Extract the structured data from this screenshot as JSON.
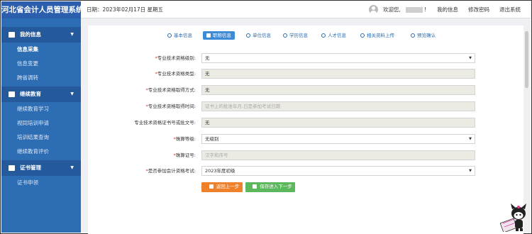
{
  "brand": "河北省会计人员管理系统",
  "header": {
    "date": "日期：2023年02月17日 星期五",
    "welcome": "欢迎您,",
    "exclaim": "!",
    "nav": [
      "我的信息",
      "修改密码",
      "退出系统"
    ]
  },
  "sidebar": {
    "groups": [
      {
        "label": "我的信息",
        "items": [
          "信息采集",
          "信息变更",
          "跨省调转"
        ]
      },
      {
        "label": "继续教育",
        "items": [
          "继续教育学习",
          "视同培训申请",
          "培训结果查询",
          "继续教育评价"
        ]
      },
      {
        "label": "证书管理",
        "items": [
          "证书申领"
        ]
      }
    ],
    "active_item": "信息采集"
  },
  "tabs": [
    "基本信息",
    "职称信息",
    "单位信息",
    "学历信息",
    "人才信息",
    "相关资料上传",
    "预览确认"
  ],
  "active_tab": "职称信息",
  "form": {
    "rows": [
      {
        "label": "专业技术资格级别:",
        "required": true,
        "type": "select",
        "value": "无"
      },
      {
        "label": "专业技术资格类型:",
        "required": true,
        "type": "readonly",
        "value": "无"
      },
      {
        "label": "专业技术资格取得方式:",
        "required": true,
        "type": "readonly",
        "value": "无"
      },
      {
        "label": "专业技术资格取得时间:",
        "required": true,
        "type": "placeholder",
        "value": "证书上的批准年月,日是参加考试日期"
      },
      {
        "label": "专业技术资格证书号或批文号:",
        "required": false,
        "type": "readonly",
        "value": "无"
      },
      {
        "label": "珠算等级:",
        "required": true,
        "type": "select",
        "value": "无级别"
      },
      {
        "label": "珠算证号:",
        "required": true,
        "type": "placeholder",
        "value": "汉字和序号"
      },
      {
        "label": "是否参加会计资格考试:",
        "required": true,
        "type": "select",
        "value": "2023年度初级"
      }
    ],
    "back_button": "返回上一步",
    "save_button": "保存进入下一步"
  },
  "colors": {
    "brand_blue": "#2b5fae",
    "sidebar_blue": "#2d6db3",
    "back_orange": "#f0812b",
    "save_green": "#5cb85c",
    "required_red": "#d9302b"
  }
}
